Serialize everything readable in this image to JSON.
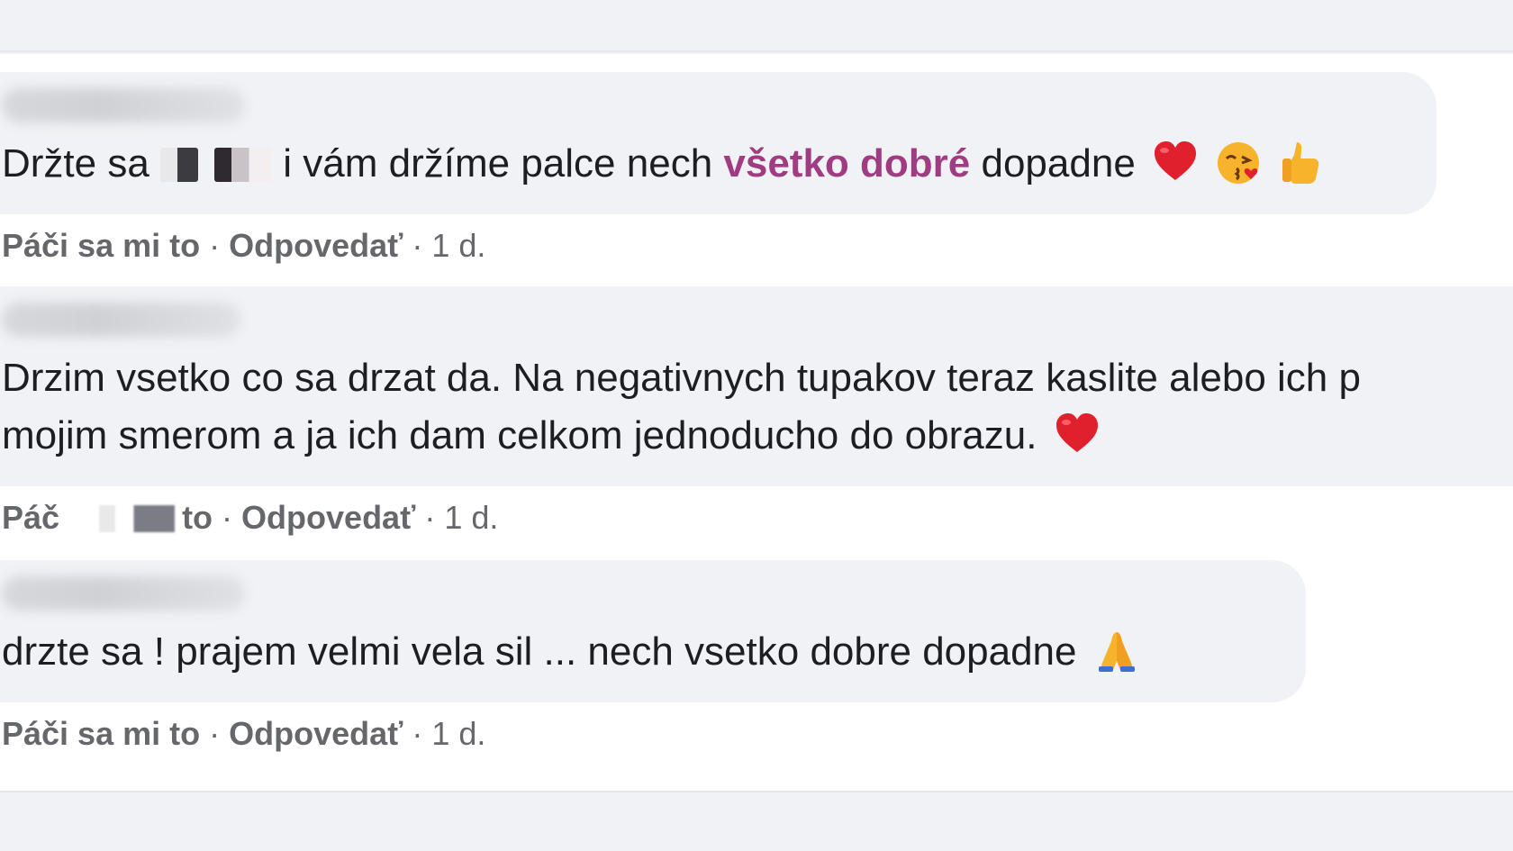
{
  "comments": [
    {
      "text_before": "Držte sa",
      "text_mid": "i vám držíme palce nech ",
      "mention": "všetko dobré",
      "text_after": " dopadne",
      "emojis": [
        "red-heart-icon",
        "kissing-face-icon",
        "thumbs-up-icon"
      ],
      "like_label": "Páči sa mi to",
      "separator": " · ",
      "reply_label": "Odpovedať",
      "time": " · 1 d."
    },
    {
      "line1": "Drzim vsetko co sa drzat da. Na negativnych tupakov teraz kaslite alebo ich p",
      "line2": "mojim smerom a ja ich dam celkom jednoducho do obrazu.",
      "emojis": [
        "red-heart-icon"
      ],
      "like_label_start": "Páč",
      "like_label_end": "to",
      "separator": " · ",
      "reply_label": "Odpovedať",
      "time": " · 1 d."
    },
    {
      "text": "drzte sa ! prajem velmi vela sil ... nech vsetko dobre dopadne",
      "emojis": [
        "folded-hands-icon"
      ],
      "like_label": "Páči sa mi to",
      "separator": " · ",
      "reply_label": "Odpovedať",
      "time": " · 1 d."
    }
  ],
  "colors": {
    "bubble": "#f0f2f5",
    "mention": "#a03c82",
    "action_text": "#65676b"
  }
}
